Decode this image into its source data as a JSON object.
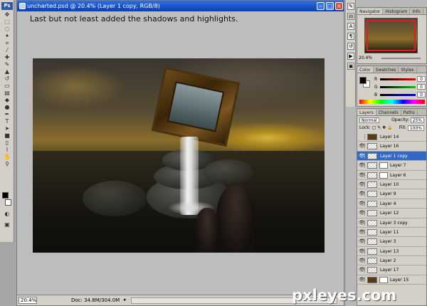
{
  "app": {
    "logo": "Ps"
  },
  "document": {
    "title": "uncharted.psd @ 20.4% (Layer 1 copy, RGB/8)",
    "zoom": "20.4%",
    "doc_size": "Doc: 34.8M/304.0M"
  },
  "caption": "Last but not least added the shadows and highlights.",
  "panels": {
    "navigator_tabs": [
      "Navigator",
      "Histogram",
      "Info"
    ],
    "navigator_zoom": "20.4%",
    "color_tabs": [
      "Color",
      "Swatches",
      "Styles"
    ],
    "color_channels": [
      {
        "label": "R",
        "value": "0"
      },
      {
        "label": "G",
        "value": "0"
      },
      {
        "label": "B",
        "value": "0"
      }
    ],
    "layers_tabs": [
      "Layers",
      "Channels",
      "Paths"
    ],
    "blend_mode": "Normal",
    "opacity_label": "Opacity:",
    "opacity_value": "25%",
    "lock_label": "Lock:",
    "fill_label": "Fill:",
    "fill_value": "100%",
    "layers": [
      {
        "name": "Layer 14",
        "visible": false,
        "selected": false,
        "thumb": "dark",
        "mask": false
      },
      {
        "name": "Layer 16",
        "visible": true,
        "selected": false,
        "thumb": "trans",
        "mask": false
      },
      {
        "name": "Layer 1 copy",
        "visible": true,
        "selected": true,
        "thumb": "trans",
        "mask": false
      },
      {
        "name": "Layer 7",
        "visible": true,
        "selected": false,
        "thumb": "trans",
        "mask": true
      },
      {
        "name": "Layer 6",
        "visible": true,
        "selected": false,
        "thumb": "trans",
        "mask": true
      },
      {
        "name": "Layer 10",
        "visible": true,
        "selected": false,
        "thumb": "trans",
        "mask": false
      },
      {
        "name": "Layer 9",
        "visible": true,
        "selected": false,
        "thumb": "trans",
        "mask": false
      },
      {
        "name": "Layer 4",
        "visible": true,
        "selected": false,
        "thumb": "trans",
        "mask": false
      },
      {
        "name": "Layer 12",
        "visible": true,
        "selected": false,
        "thumb": "trans",
        "mask": false
      },
      {
        "name": "Layer 3 copy",
        "visible": true,
        "selected": false,
        "thumb": "trans",
        "mask": false
      },
      {
        "name": "Layer 11",
        "visible": true,
        "selected": false,
        "thumb": "trans",
        "mask": false
      },
      {
        "name": "Layer 3",
        "visible": true,
        "selected": false,
        "thumb": "trans",
        "mask": false
      },
      {
        "name": "Layer 13",
        "visible": true,
        "selected": false,
        "thumb": "trans",
        "mask": false
      },
      {
        "name": "Layer 2",
        "visible": true,
        "selected": false,
        "thumb": "trans",
        "mask": false
      },
      {
        "name": "Layer 17",
        "visible": true,
        "selected": false,
        "thumb": "trans",
        "mask": false
      },
      {
        "name": "Layer 15",
        "visible": true,
        "selected": false,
        "thumb": "dark",
        "mask": true
      }
    ]
  },
  "watermark": "pxleyes.com"
}
